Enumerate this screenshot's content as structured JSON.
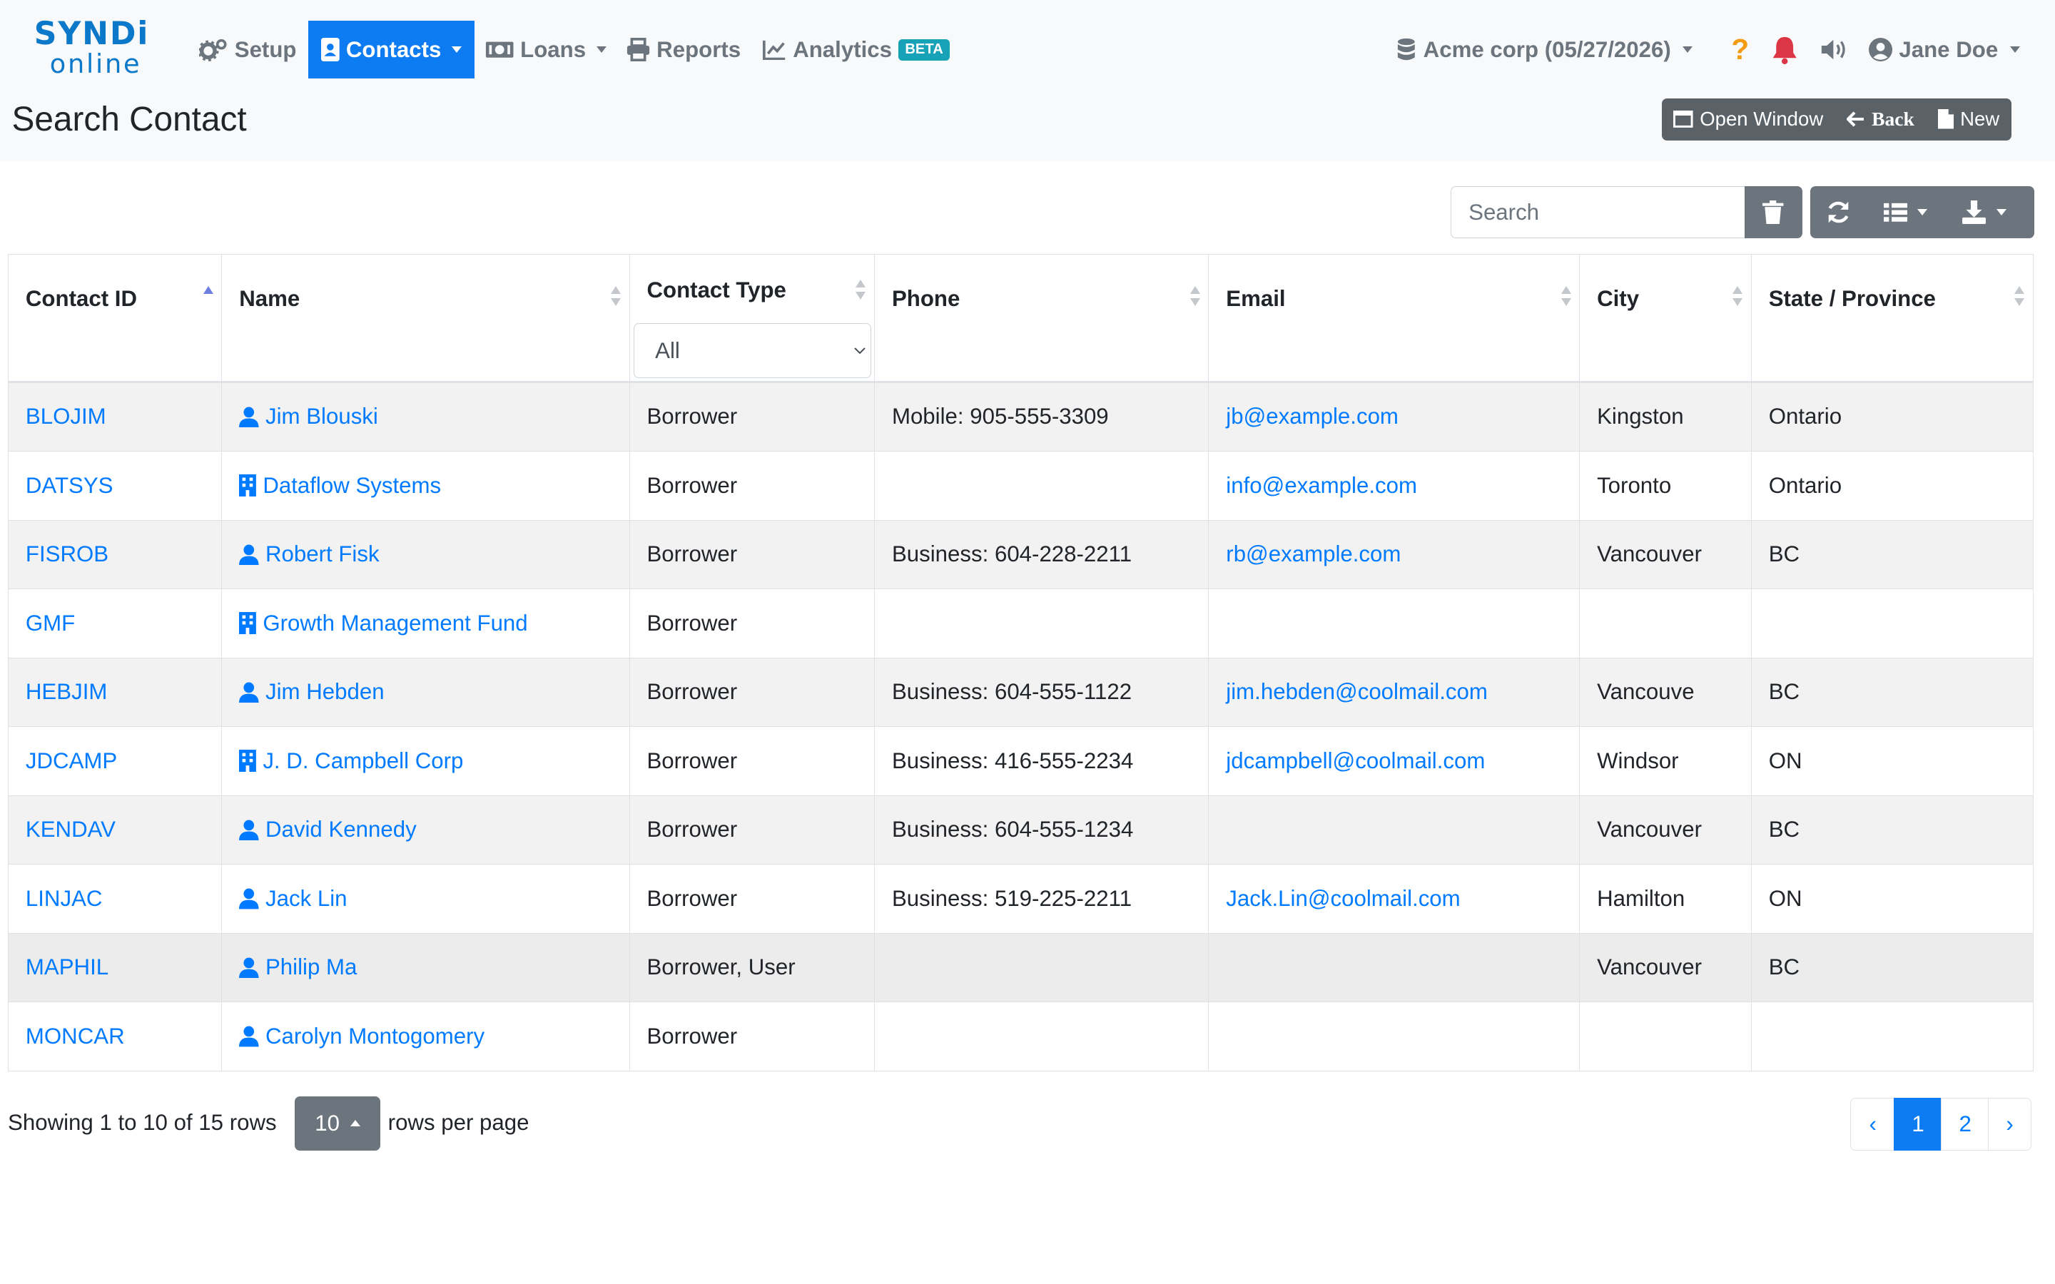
{
  "brand": {
    "line1": "SYNDi",
    "line2": "online"
  },
  "nav": {
    "setup": "Setup",
    "contacts": "Contacts",
    "loans": "Loans",
    "reports": "Reports",
    "analytics": "Analytics",
    "analytics_badge": "BETA",
    "company": "Acme corp (05/27/2026)",
    "help": "?",
    "user": "Jane Doe"
  },
  "page": {
    "title": "Search Contact",
    "actions": {
      "open_window": "Open Window",
      "back": "Back",
      "new": "New"
    }
  },
  "toolbar": {
    "search_placeholder": "Search"
  },
  "table": {
    "headers": {
      "contact_id": "Contact ID",
      "name": "Name",
      "contact_type": "Contact Type",
      "phone": "Phone",
      "email": "Email",
      "city": "City",
      "state": "State / Province"
    },
    "contact_type_filter": "All",
    "rows": [
      {
        "id": "BLOJIM",
        "kind": "person",
        "name": "Jim Blouski",
        "type": "Borrower",
        "phone": "Mobile: 905-555-3309",
        "email": "jb@example.com",
        "city": "Kingston",
        "state": "Ontario"
      },
      {
        "id": "DATSYS",
        "kind": "company",
        "name": "Dataflow Systems",
        "type": "Borrower",
        "phone": "",
        "email": "info@example.com",
        "city": "Toronto",
        "state": "Ontario"
      },
      {
        "id": "FISROB",
        "kind": "person",
        "name": "Robert Fisk",
        "type": "Borrower",
        "phone": "Business: 604-228-2211",
        "email": "rb@example.com",
        "city": "Vancouver",
        "state": "BC"
      },
      {
        "id": "GMF",
        "kind": "company",
        "name": "Growth Management Fund",
        "type": "Borrower",
        "phone": "",
        "email": "",
        "city": "",
        "state": ""
      },
      {
        "id": "HEBJIM",
        "kind": "person",
        "name": "Jim Hebden",
        "type": "Borrower",
        "phone": "Business: 604-555-1122",
        "email": "jim.hebden@coolmail.com",
        "city": "Vancouve",
        "state": "BC"
      },
      {
        "id": "JDCAMP",
        "kind": "company",
        "name": "J. D. Campbell Corp",
        "type": "Borrower",
        "phone": "Business: 416-555-2234",
        "email": "jdcampbell@coolmail.com",
        "city": "Windsor",
        "state": "ON"
      },
      {
        "id": "KENDAV",
        "kind": "person",
        "name": "David Kennedy",
        "type": "Borrower",
        "phone": "Business: 604-555-1234",
        "email": "",
        "city": "Vancouver",
        "state": "BC"
      },
      {
        "id": "LINJAC",
        "kind": "person",
        "name": "Jack Lin",
        "type": "Borrower",
        "phone": "Business: 519-225-2211",
        "email": "Jack.Lin@coolmail.com",
        "city": "Hamilton",
        "state": "ON"
      },
      {
        "id": "MAPHIL",
        "kind": "person",
        "name": "Philip Ma",
        "type": "Borrower, User",
        "phone": "",
        "email": "",
        "city": "Vancouver",
        "state": "BC"
      },
      {
        "id": "MONCAR",
        "kind": "person",
        "name": "Carolyn Montogomery",
        "type": "Borrower",
        "phone": "",
        "email": "",
        "city": "",
        "state": ""
      }
    ]
  },
  "footer": {
    "showing": "Showing 1 to 10 of 15 rows",
    "rows_per_page_value": "10",
    "rows_per_page_label": "rows per page",
    "pages": {
      "prev": "‹",
      "p1": "1",
      "p2": "2",
      "next": "›"
    }
  },
  "colors": {
    "primary": "#0d7bf2",
    "link": "#007bff",
    "secondary": "#6c757d",
    "dark_group": "#5a6268",
    "brand": "#0b78c9",
    "help": "#f39c12",
    "bell": "#dc3545"
  }
}
